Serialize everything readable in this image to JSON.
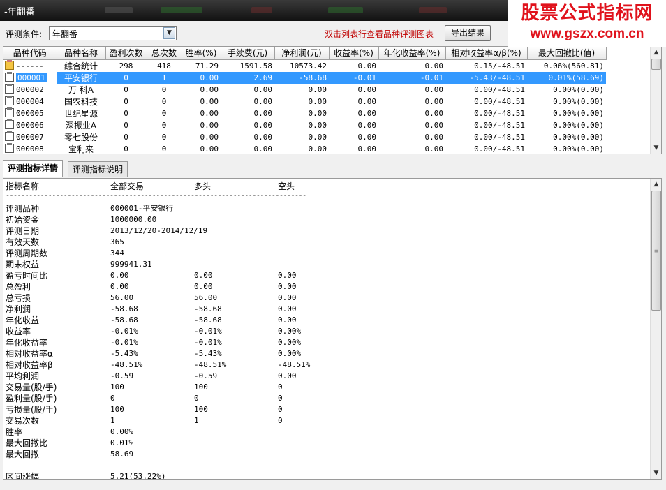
{
  "window": {
    "title": "-年翻番"
  },
  "watermark": {
    "line1": "股票公式指标网",
    "line2": "www.gszx.com.cn"
  },
  "condition": {
    "label": "评测条件:",
    "value": "年翻番"
  },
  "hint": "双击列表行查看品种评测图表",
  "export_label": "导出结果",
  "grid": {
    "columns": [
      "品种代码",
      "品种名称",
      "盈利次数",
      "总次数",
      "胜率(%)",
      "手续费(元)",
      "净利润(元)",
      "收益率(%)",
      "年化收益率(%)",
      "相对收益率α/β(%)",
      "最大回撤比(值)"
    ],
    "rows": [
      {
        "code": "------",
        "name": "综合统计",
        "win": "298",
        "total": "418",
        "rate": "71.29",
        "fee": "1591.58",
        "net": "10573.42",
        "ret": "0.00",
        "annual": "0.00",
        "rel": "0.15/-48.51",
        "dd": "0.06%(560.81)",
        "icon": "folder",
        "selected": false
      },
      {
        "code": "000001",
        "name": "平安银行",
        "win": "0",
        "total": "1",
        "rate": "0.00",
        "fee": "2.69",
        "net": "-58.68",
        "ret": "-0.01",
        "annual": "-0.01",
        "rel": "-5.43/-48.51",
        "dd": "0.01%(58.69)",
        "icon": "doc",
        "selected": true
      },
      {
        "code": "000002",
        "name": "万 科A",
        "win": "0",
        "total": "0",
        "rate": "0.00",
        "fee": "0.00",
        "net": "0.00",
        "ret": "0.00",
        "annual": "0.00",
        "rel": "0.00/-48.51",
        "dd": "0.00%(0.00)",
        "icon": "doc",
        "selected": false
      },
      {
        "code": "000004",
        "name": "国农科技",
        "win": "0",
        "total": "0",
        "rate": "0.00",
        "fee": "0.00",
        "net": "0.00",
        "ret": "0.00",
        "annual": "0.00",
        "rel": "0.00/-48.51",
        "dd": "0.00%(0.00)",
        "icon": "doc",
        "selected": false
      },
      {
        "code": "000005",
        "name": "世纪星源",
        "win": "0",
        "total": "0",
        "rate": "0.00",
        "fee": "0.00",
        "net": "0.00",
        "ret": "0.00",
        "annual": "0.00",
        "rel": "0.00/-48.51",
        "dd": "0.00%(0.00)",
        "icon": "doc",
        "selected": false
      },
      {
        "code": "000006",
        "name": "深振业A",
        "win": "0",
        "total": "0",
        "rate": "0.00",
        "fee": "0.00",
        "net": "0.00",
        "ret": "0.00",
        "annual": "0.00",
        "rel": "0.00/-48.51",
        "dd": "0.00%(0.00)",
        "icon": "doc",
        "selected": false
      },
      {
        "code": "000007",
        "name": "零七股份",
        "win": "0",
        "total": "0",
        "rate": "0.00",
        "fee": "0.00",
        "net": "0.00",
        "ret": "0.00",
        "annual": "0.00",
        "rel": "0.00/-48.51",
        "dd": "0.00%(0.00)",
        "icon": "doc",
        "selected": false
      },
      {
        "code": "000008",
        "name": "宝利来",
        "win": "0",
        "total": "0",
        "rate": "0.00",
        "fee": "0.00",
        "net": "0.00",
        "ret": "0.00",
        "annual": "0.00",
        "rel": "0.00/-48.51",
        "dd": "0.00%(0.00)",
        "icon": "doc",
        "selected": false
      }
    ]
  },
  "tabs": [
    {
      "label": "评测指标详情",
      "active": true
    },
    {
      "label": "评测指标说明",
      "active": false
    }
  ],
  "detail": {
    "headers": {
      "name": "指标名称",
      "all": "全部交易",
      "long": "多头",
      "short": "空头"
    },
    "dashes": "------------------------------------------------------------------------------",
    "rows": [
      {
        "label": "评测品种",
        "all": "000001-平安银行",
        "long": "",
        "short": ""
      },
      {
        "label": "初始资金",
        "all": "1000000.00",
        "long": "",
        "short": ""
      },
      {
        "label": "评测日期",
        "all": "2013/12/20-2014/12/19",
        "long": "",
        "short": ""
      },
      {
        "label": "有效天数",
        "all": "365",
        "long": "",
        "short": ""
      },
      {
        "label": "评测周期数",
        "all": "344",
        "long": "",
        "short": ""
      },
      {
        "label": "期末权益",
        "all": "999941.31",
        "long": "",
        "short": ""
      },
      {
        "label": "盈亏时间比",
        "all": "0.00",
        "long": "0.00",
        "short": "0.00"
      },
      {
        "label": "总盈利",
        "all": "0.00",
        "long": "0.00",
        "short": "0.00"
      },
      {
        "label": "总亏损",
        "all": "56.00",
        "long": "56.00",
        "short": "0.00"
      },
      {
        "label": "净利润",
        "all": "-58.68",
        "long": "-58.68",
        "short": "0.00"
      },
      {
        "label": "年化收益",
        "all": "-58.68",
        "long": "-58.68",
        "short": "0.00"
      },
      {
        "label": "收益率",
        "all": "-0.01%",
        "long": "-0.01%",
        "short": "0.00%"
      },
      {
        "label": "年化收益率",
        "all": "-0.01%",
        "long": "-0.01%",
        "short": "0.00%"
      },
      {
        "label": "相对收益率α",
        "all": "-5.43%",
        "long": "-5.43%",
        "short": "0.00%"
      },
      {
        "label": "相对收益率β",
        "all": "-48.51%",
        "long": "-48.51%",
        "short": "-48.51%"
      },
      {
        "label": "平均利润",
        "all": "-0.59",
        "long": "-0.59",
        "short": "0.00"
      },
      {
        "label": "交易量(股/手)",
        "all": "100",
        "long": "100",
        "short": "0"
      },
      {
        "label": "盈利量(股/手)",
        "all": "0",
        "long": "0",
        "short": "0"
      },
      {
        "label": "亏损量(股/手)",
        "all": "100",
        "long": "100",
        "short": "0"
      },
      {
        "label": "交易次数",
        "all": "1",
        "long": "1",
        "short": "0"
      },
      {
        "label": "胜率",
        "all": "0.00%",
        "long": "",
        "short": ""
      },
      {
        "label": "最大回撤比",
        "all": "0.01%",
        "long": "",
        "short": ""
      },
      {
        "label": "最大回撤",
        "all": "58.69",
        "long": "",
        "short": ""
      },
      {
        "label": "",
        "all": "",
        "long": "",
        "short": ""
      },
      {
        "label": "区间涨幅",
        "all": "5.21(53.22%)",
        "long": "",
        "short": ""
      }
    ]
  }
}
